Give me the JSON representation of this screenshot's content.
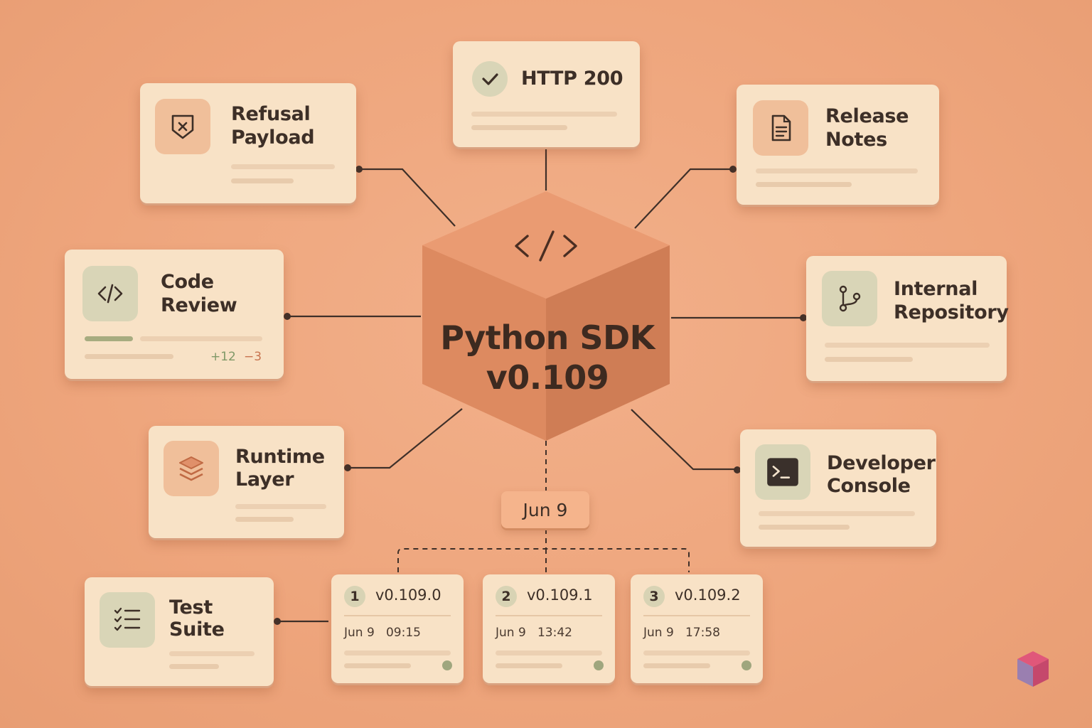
{
  "center": {
    "icon": "code-icon",
    "title_line1": "Python SDK",
    "title_line2": "v0.109",
    "color": "#e4946a"
  },
  "cards": {
    "http": {
      "icon": "check-icon",
      "title": "HTTP 200"
    },
    "refusal": {
      "icon": "shield-x-icon",
      "title_line1": "Refusal",
      "title_line2": "Payload"
    },
    "release": {
      "icon": "document-icon",
      "title_line1": "Release",
      "title_line2": "Notes"
    },
    "code_review": {
      "icon": "code-icon",
      "title_line1": "Code",
      "title_line2": "Review",
      "additions": "+12",
      "deletions": "−3"
    },
    "repository": {
      "icon": "git-branch-icon",
      "title_line1": "Internal",
      "title_line2": "Repository"
    },
    "runtime": {
      "icon": "layers-icon",
      "title_line1": "Runtime",
      "title_line2": "Layer"
    },
    "console": {
      "icon": "terminal-icon",
      "title_line1": "Developer",
      "title_line2": "Console"
    },
    "tests": {
      "icon": "checklist-icon",
      "title_line1": "Test",
      "title_line2": "Suite"
    }
  },
  "date": {
    "label": "Jun 9"
  },
  "versions": [
    {
      "number": "1",
      "version": "v0.109.0",
      "time": "Jun 9   09:15"
    },
    {
      "number": "2",
      "version": "v0.109.1",
      "time": "Jun 9   13:42"
    },
    {
      "number": "3",
      "version": "v0.109.2",
      "time": "Jun 9   17:58"
    }
  ],
  "colors": {
    "background": "#eea77e",
    "card": "#f8e2c6",
    "text": "#3d2f27",
    "accent_green": "#9fa67e",
    "accent_orange": "#e0906a"
  }
}
